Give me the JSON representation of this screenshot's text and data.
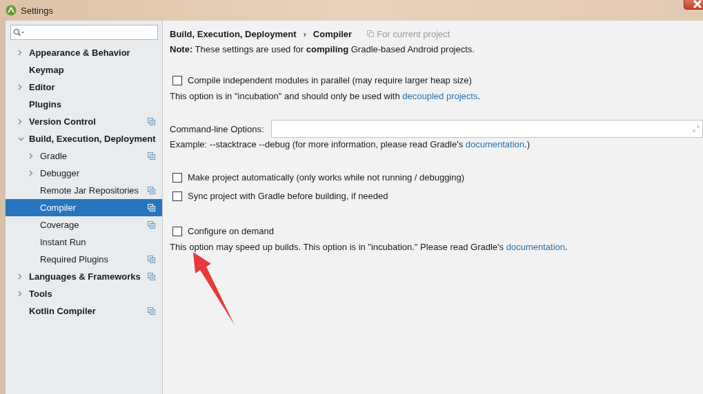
{
  "window": {
    "title": "Settings"
  },
  "tree": [
    {
      "label": "Appearance & Behavior",
      "kind": "group",
      "expanded": false,
      "selected": false,
      "project_scope": false
    },
    {
      "label": "Keymap",
      "kind": "leaf",
      "selected": false,
      "project_scope": false
    },
    {
      "label": "Editor",
      "kind": "group",
      "expanded": false,
      "selected": false,
      "project_scope": false
    },
    {
      "label": "Plugins",
      "kind": "leaf",
      "selected": false,
      "project_scope": false
    },
    {
      "label": "Version Control",
      "kind": "group",
      "expanded": false,
      "selected": false,
      "project_scope": true
    },
    {
      "label": "Build, Execution, Deployment",
      "kind": "group",
      "expanded": true,
      "selected": false,
      "project_scope": false,
      "children": [
        {
          "label": "Gradle",
          "kind": "group",
          "expanded": false,
          "selected": false,
          "project_scope": true
        },
        {
          "label": "Debugger",
          "kind": "group",
          "expanded": false,
          "selected": false,
          "project_scope": false
        },
        {
          "label": "Remote Jar Repositories",
          "kind": "leaf",
          "selected": false,
          "project_scope": true
        },
        {
          "label": "Compiler",
          "kind": "leaf",
          "selected": true,
          "project_scope": true
        },
        {
          "label": "Coverage",
          "kind": "leaf",
          "selected": false,
          "project_scope": true
        },
        {
          "label": "Instant Run",
          "kind": "leaf",
          "selected": false,
          "project_scope": false
        },
        {
          "label": "Required Plugins",
          "kind": "leaf",
          "selected": false,
          "project_scope": true
        }
      ]
    },
    {
      "label": "Languages & Frameworks",
      "kind": "group",
      "expanded": false,
      "selected": false,
      "project_scope": true
    },
    {
      "label": "Tools",
      "kind": "group",
      "expanded": false,
      "selected": false,
      "project_scope": false
    },
    {
      "label": "Kotlin Compiler",
      "kind": "leaf",
      "selected": false,
      "project_scope": true
    }
  ],
  "breadcrumb": [
    "Build, Execution, Deployment",
    "Compiler"
  ],
  "breadcrumb_separator": "›",
  "scope_note": "For current project",
  "note": "**Note:** These settings are used for **compiling** Gradle-based Android projects.",
  "sections": [
    [
      {
        "kind": "checkbox",
        "label": "Compile independent modules in parallel (may require larger heap size)",
        "checked": false
      },
      {
        "kind": "hint",
        "text": "This option is in \"incubation\" and should only be used with ",
        "link": "decoupled projects",
        "after": "."
      }
    ],
    [
      {
        "kind": "field",
        "label": "Command-line Options:"
      },
      {
        "kind": "hint",
        "text": "Example: --stacktrace --debug (for more information, please read Gradle's ",
        "link": "documentation",
        "after": ".)"
      }
    ],
    [
      {
        "kind": "checkbox",
        "label": "Make project automatically (only works while not running / debugging)",
        "checked": false
      },
      {
        "kind": "checkbox",
        "label": "Sync project with Gradle before building, if needed",
        "checked": false
      }
    ],
    [
      {
        "kind": "checkbox",
        "label": "Configure on demand",
        "checked": false
      },
      {
        "kind": "hint",
        "text": "This option may speed up builds. This option is in \"incubation.\" Please read Gradle's ",
        "link": "documentation",
        "after": "."
      }
    ]
  ]
}
